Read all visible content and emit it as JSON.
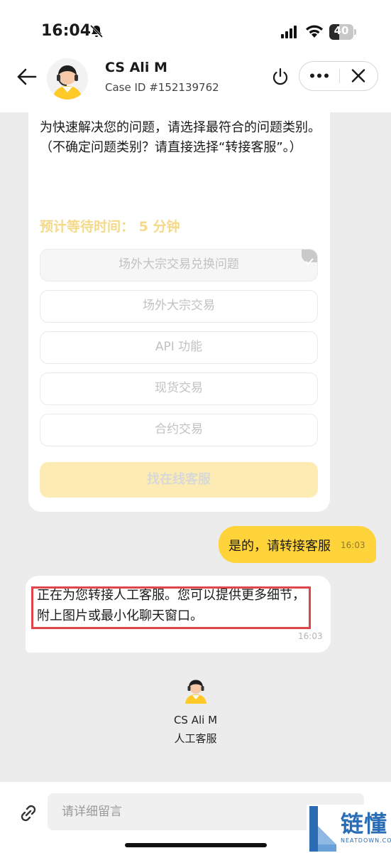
{
  "status_bar": {
    "time": "16:04",
    "battery_text": "40",
    "battery_level": 0.4,
    "icons": [
      "bell-slash-icon",
      "signal-icon",
      "wifi-icon",
      "battery-icon"
    ]
  },
  "header": {
    "agent_name": "CS Ali M",
    "case_id": "Case ID #152139762",
    "icons": [
      "back-arrow-icon",
      "power-icon",
      "more-icon",
      "close-icon"
    ]
  },
  "bot_card": {
    "intro": "为快速解决您的问题，请选择最符合的问题类别。\n（不确定问题类别？请直接选择“转接客服”。）",
    "wait_time": "预计等待时间： 5 分钟",
    "options": [
      {
        "label": "场外大宗交易兑换问题",
        "selected": true
      },
      {
        "label": "场外大宗交易",
        "selected": false
      },
      {
        "label": "API 功能",
        "selected": false
      },
      {
        "label": "现货交易",
        "selected": false
      },
      {
        "label": "合约交易",
        "selected": false
      }
    ],
    "human_button": "找在线客服"
  },
  "user_message": {
    "text": "是的，请转接客服",
    "time": "16:03"
  },
  "bot_message": {
    "text": "正在为您转接人工客服。您可以提供更多细节，附上图片或最小化聊天窗口。",
    "time": "16:03"
  },
  "agent_card": {
    "name": "CS Ali M",
    "role": "人工客服"
  },
  "input_bar": {
    "placeholder": "请详细留言",
    "icons": [
      "paperclip-icon"
    ]
  },
  "watermark": {
    "text": "链懂",
    "sub": "NEATDOWN.COM"
  },
  "colors": {
    "accent": "#ffd43b",
    "wait_text": "#f5d98a",
    "highlight_border": "#e0454c",
    "background": "#ececec"
  }
}
